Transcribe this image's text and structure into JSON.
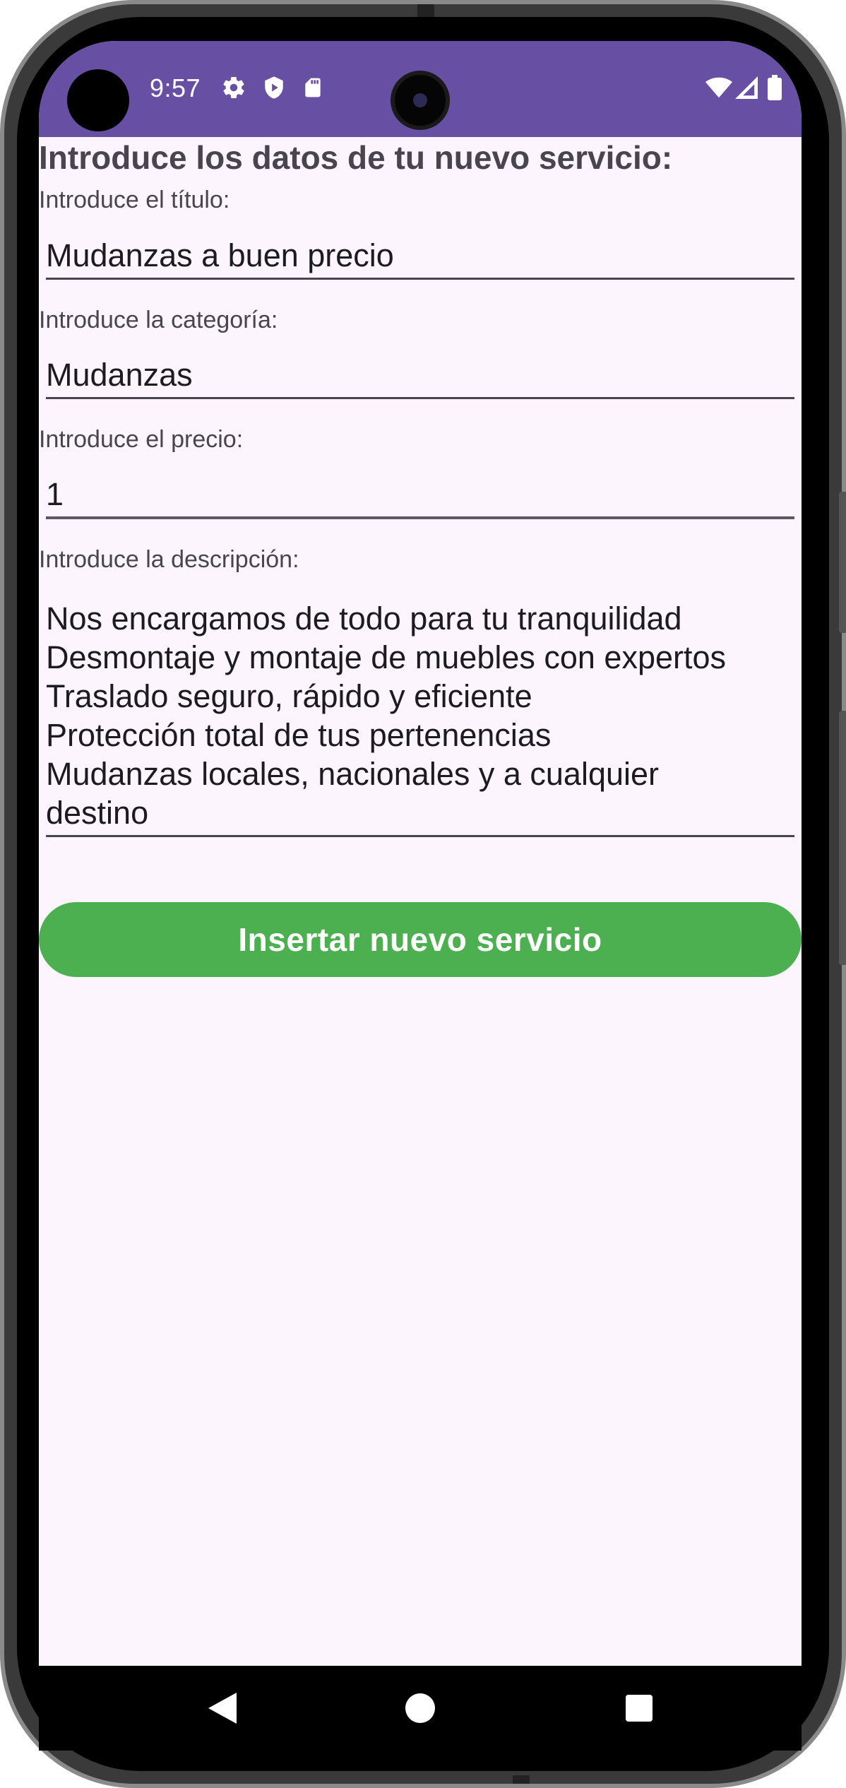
{
  "status_bar": {
    "time": "9:57",
    "icons_left": [
      "gear-icon",
      "shield-icon",
      "sd-card-icon"
    ],
    "icons_right": [
      "wifi-icon",
      "signal-icon",
      "battery-icon"
    ]
  },
  "form": {
    "heading": "Introduce los datos de tu nuevo servicio:",
    "title_label": "Introduce el título:",
    "title_value": "Mudanzas a buen precio",
    "category_label": "Introduce la categoría:",
    "category_value": "Mudanzas",
    "price_label": "Introduce el precio:",
    "price_value": "1",
    "description_label": "Introduce la descripción:",
    "description_value": "Nos encargamos de todo para tu tranquilidad\nDesmontaje y montaje de muebles con expertos\nTraslado seguro, rápido y eficiente\nProtección total de tus pertenencias\nMudanzas locales, nacionales y a cualquier\ndestino",
    "submit_label": "Insertar nuevo servicio"
  },
  "nav_bar": {
    "buttons": [
      "back-icon",
      "home-icon",
      "recents-icon"
    ]
  },
  "colors": {
    "status_bar": "#6750a4",
    "background": "#fcf5fd",
    "submit_button": "#4caf50",
    "text_label": "#49454f",
    "text_value": "#1d1b20"
  }
}
